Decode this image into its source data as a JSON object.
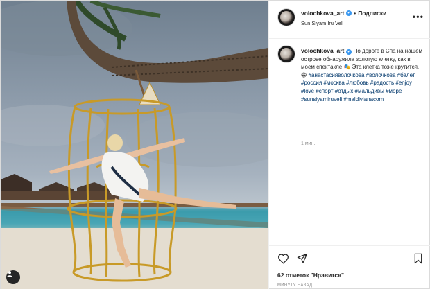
{
  "header": {
    "username": "volochkova_art",
    "verified_mark": "✔",
    "separator": "•",
    "follow_label": "Подписки",
    "location": "Sun Siyam Iru Veli",
    "more_icon": "ellipsis-icon"
  },
  "post": {
    "photo_alt": "photo",
    "caption_text": "По дороге в Спа на нашем острове обнаружила золотую клетку, как в моем спектакле.🎭 Эта клетка тоже крутится.😁",
    "hashtags": "#анастасияволочкова #волочкова #балет #россия #москва #любовь #радость #enjoy #love #спорт #отдых #мальдивы #море #sunsiyamiruveli #maldivianacom",
    "time": "1 мин.",
    "likes_count": "62 отметок",
    "likes_suffix": "\"Нравится\"",
    "posted_ago": "МИНУТУ НАЗАД"
  },
  "icons": {
    "like": "heart-icon",
    "share": "paper-plane-icon",
    "save": "bookmark-icon",
    "user": "user-icon"
  }
}
